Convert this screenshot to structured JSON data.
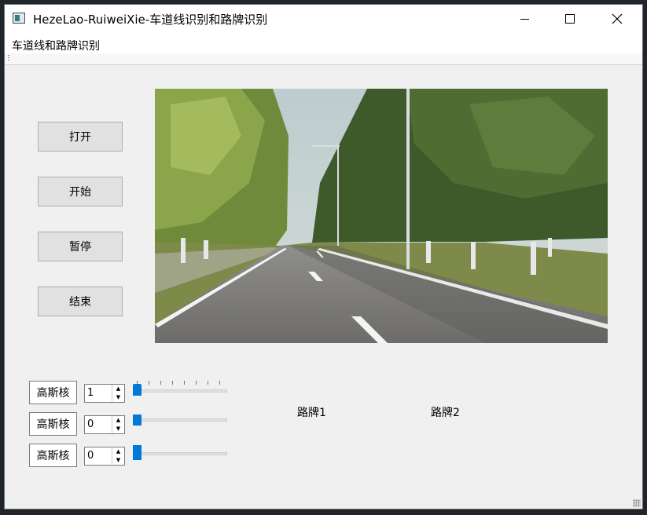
{
  "window": {
    "title": "HezeLao-RuiweiXie-车道线识别和路牌识别",
    "controls": [
      "minimize",
      "maximize",
      "close"
    ]
  },
  "menu": {
    "items": [
      "车道线和路牌识别"
    ]
  },
  "buttons": {
    "open": "打开",
    "start": "开始",
    "pause": "暂停",
    "stop": "结束"
  },
  "controls": [
    {
      "label": "高斯核",
      "value": "1",
      "slider_value": 0,
      "ticks": true
    },
    {
      "label": "高斯核",
      "value": "0",
      "slider_value": 0,
      "ticks": false
    },
    {
      "label": "高斯核",
      "value": "0",
      "slider_value": 0,
      "ticks": false
    }
  ],
  "signs": {
    "sign1": "路牌1",
    "sign2": "路牌2"
  },
  "video": {
    "description_icon": "road-video-frame"
  },
  "colors": {
    "accent": "#0078d7",
    "window_bg": "#f0f0f0"
  }
}
